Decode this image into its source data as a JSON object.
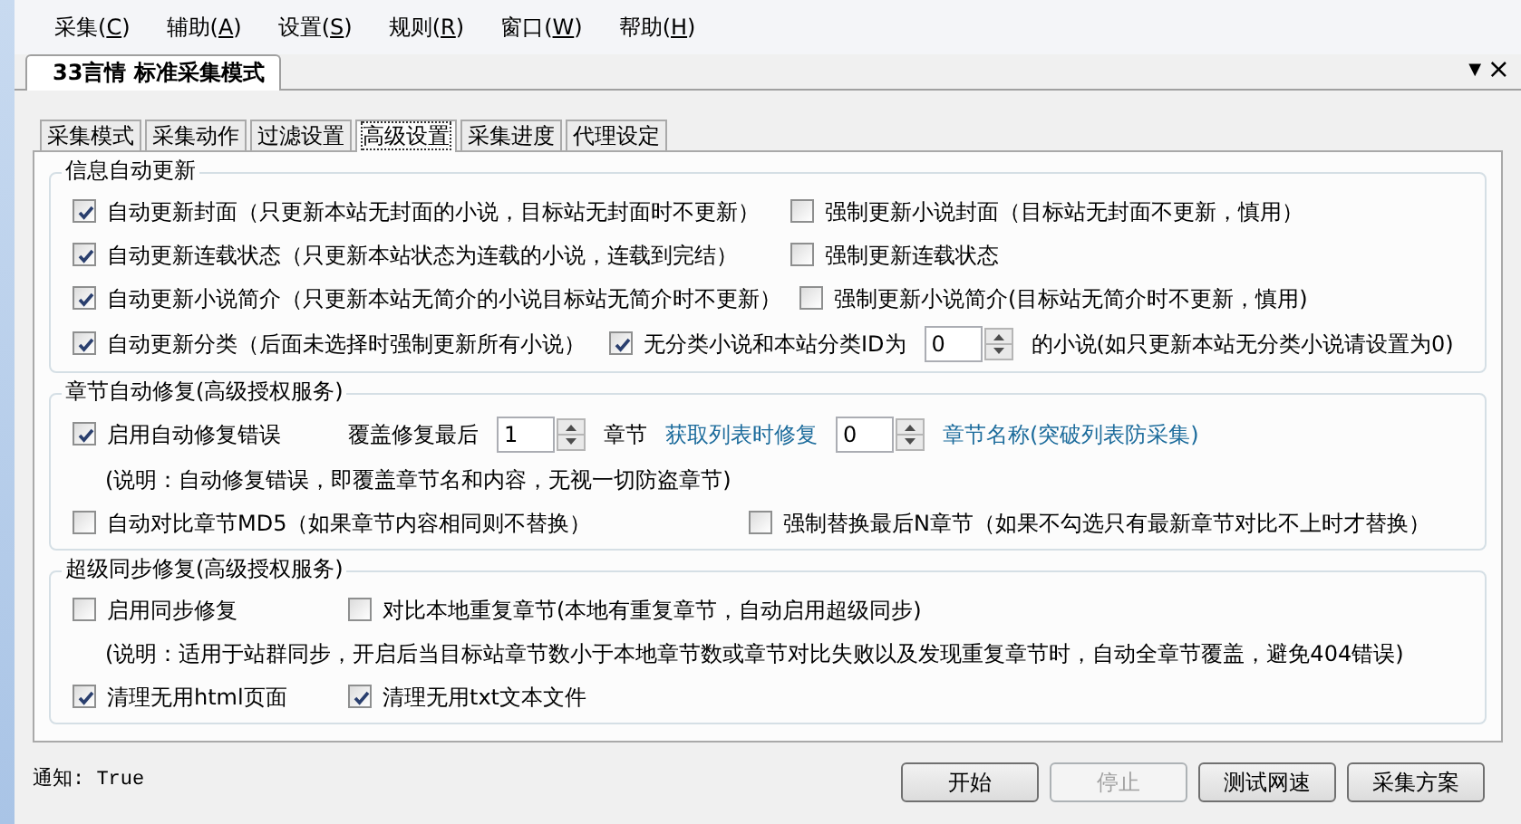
{
  "menu": [
    {
      "label": "采集(C)"
    },
    {
      "label": "辅助(A)"
    },
    {
      "label": "设置(S)"
    },
    {
      "label": "规则(R)"
    },
    {
      "label": "窗口(W)"
    },
    {
      "label": "帮助(H)"
    }
  ],
  "document_tab": {
    "title": "33言情 标准采集模式",
    "selected": true
  },
  "tab_controls": {
    "dropdown": "▼",
    "close": "×"
  },
  "tabs": [
    {
      "label": "采集模式",
      "selected": false
    },
    {
      "label": "采集动作",
      "selected": false
    },
    {
      "label": "过滤设置",
      "selected": false
    },
    {
      "label": "高级设置",
      "selected": true
    },
    {
      "label": "采集进度",
      "selected": false
    },
    {
      "label": "代理设定",
      "selected": false
    }
  ],
  "groups": [
    {
      "title": "信息自动更新",
      "rows": [
        [
          {
            "kind": "checkbox",
            "label": "自动更新封面（只更新本站无封面的小说，目标站无封面时不更新）",
            "checked": true
          },
          {
            "kind": "checkbox",
            "label": "强制更新小说封面（目标站无封面不更新，慎用）",
            "checked": false
          }
        ],
        [
          {
            "kind": "checkbox",
            "label": "自动更新连载状态（只更新本站状态为连载的小说，连载到完结）",
            "checked": true
          },
          {
            "kind": "checkbox",
            "label": "强制更新连载状态",
            "checked": false
          }
        ],
        [
          {
            "kind": "checkbox",
            "label": "自动更新小说简介（只更新本站无简介的小说目标站无简介时不更新）",
            "checked": true
          },
          {
            "kind": "checkbox",
            "label": "强制更新小说简介(目标站无简介时不更新，慎用)",
            "checked": false
          }
        ],
        [
          {
            "kind": "checkbox",
            "label": "自动更新分类（后面未选择时强制更新所有小说）",
            "checked": true
          },
          {
            "kind": "checkbox",
            "label": "无分类小说和本站分类ID为",
            "checked": true
          },
          {
            "kind": "spin",
            "value": "0"
          },
          {
            "kind": "text",
            "label": "的小说(如只更新本站无分类小说请设置为0)"
          }
        ]
      ]
    },
    {
      "title": "章节自动修复(高级授权服务)",
      "rows": [
        [
          {
            "kind": "checkbox",
            "label": "启用自动修复错误",
            "checked": true
          },
          {
            "kind": "text",
            "label": "覆盖修复最后"
          },
          {
            "kind": "spin",
            "value": "1"
          },
          {
            "kind": "text",
            "label": "章节"
          },
          {
            "kind": "link",
            "label": "获取列表时修复"
          },
          {
            "kind": "spin",
            "value": "0"
          },
          {
            "kind": "link",
            "label": "章节名称(突破列表防采集)"
          }
        ],
        {
          "note": "(说明：自动修复错误，即覆盖章节名和内容，无视一切防盗章节)"
        },
        [
          {
            "kind": "checkbox",
            "label": "自动对比章节MD5（如果章节内容相同则不替换）",
            "checked": false
          },
          {
            "kind": "checkbox",
            "label": "强制替换最后N章节（如果不勾选只有最新章节对比不上时才替换）",
            "checked": false
          }
        ]
      ]
    },
    {
      "title": "超级同步修复(高级授权服务)",
      "rows": [
        [
          {
            "kind": "checkbox",
            "label": "启用同步修复",
            "checked": false
          },
          {
            "kind": "checkbox",
            "label": "对比本地重复章节(本地有重复章节，自动启用超级同步)",
            "checked": false
          }
        ],
        {
          "note": "(说明：适用于站群同步，开启后当目标站章节数小于本地章节数或章节对比失败以及发现重复章节时，自动全章节覆盖，避免404错误)"
        },
        [
          {
            "kind": "checkbox",
            "label": "清理无用html页面",
            "checked": true
          },
          {
            "kind": "checkbox",
            "label": "清理无用txt文本文件",
            "checked": true
          }
        ]
      ]
    }
  ],
  "status": "通知: True",
  "buttons": [
    {
      "label": "开始",
      "disabled": false
    },
    {
      "label": "停止",
      "disabled": true
    },
    {
      "label": "测试网速",
      "disabled": false
    },
    {
      "label": "采集方案",
      "disabled": false
    }
  ]
}
